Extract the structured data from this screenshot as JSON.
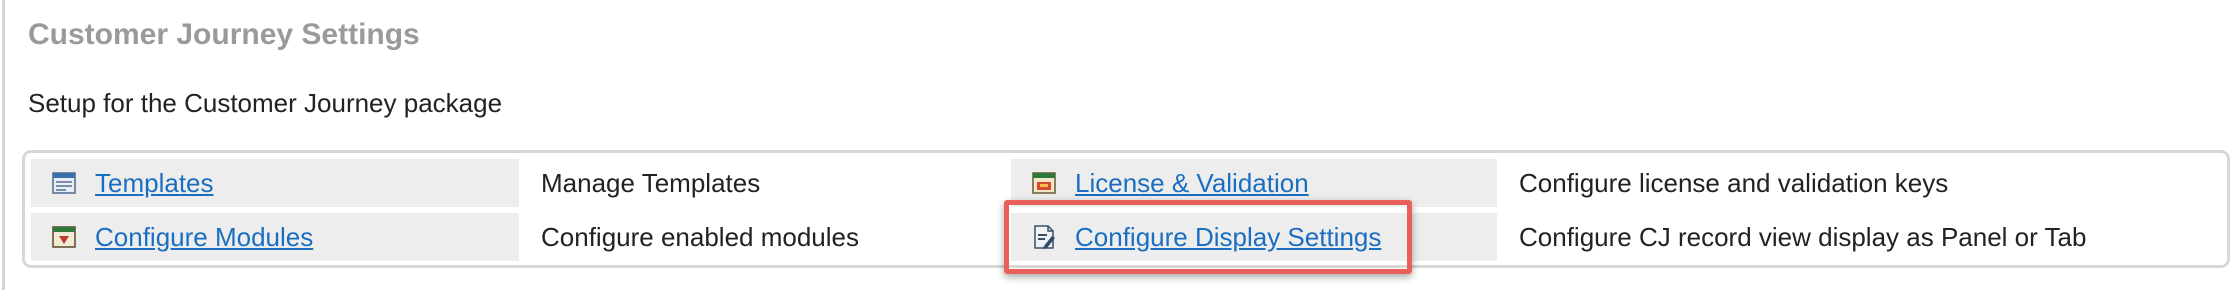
{
  "header": {
    "title": "Customer Journey Settings",
    "subtitle": "Setup for the Customer Journey package"
  },
  "settings": {
    "rows": [
      [
        {
          "label": "Templates",
          "description": "Manage Templates",
          "icon": "templates-icon"
        },
        {
          "label": "License & Validation",
          "description": "Configure license and validation keys",
          "icon": "license-icon"
        }
      ],
      [
        {
          "label": "Configure Modules",
          "description": "Configure enabled modules",
          "icon": "modules-icon"
        },
        {
          "label": "Configure Display Settings",
          "description": "Configure CJ record view display as Panel or Tab",
          "icon": "display-settings-icon"
        }
      ]
    ]
  },
  "highlight": {
    "target": "Configure Display Settings",
    "color": "#e8605a"
  },
  "colors": {
    "link": "#1a6ec2",
    "title": "#9a9a9a",
    "link_cell_bg": "#ededed"
  }
}
